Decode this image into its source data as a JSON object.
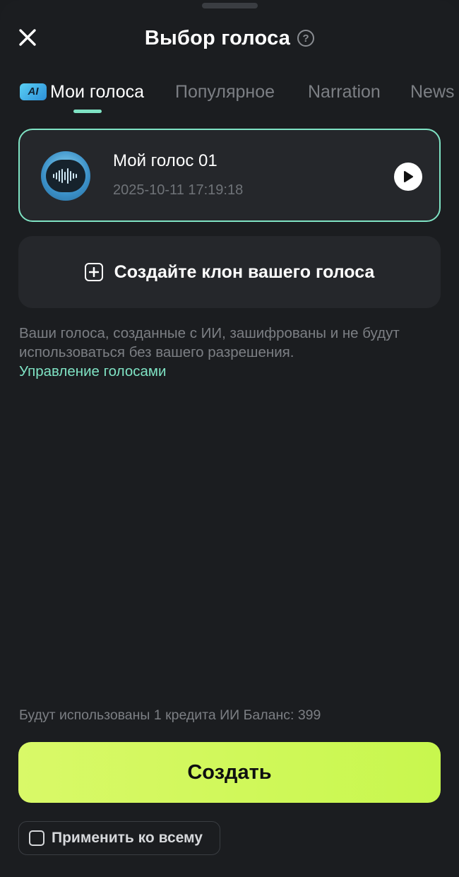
{
  "header": {
    "title": "Выбор голоса",
    "close_icon": "close-icon",
    "help_icon": "question-circle-icon"
  },
  "tabs": [
    {
      "label": "Мои голоса",
      "badge": "AI",
      "active": true
    },
    {
      "label": "Популярное",
      "active": false
    },
    {
      "label": "Narration",
      "active": false
    },
    {
      "label": "News",
      "active": false
    }
  ],
  "voices": [
    {
      "name": "Мой голос 01",
      "date": "2025-10-11 17:19:18",
      "selected": true,
      "avatar_icon": "waveform-avatar-icon",
      "play_icon": "play-icon"
    }
  ],
  "clone": {
    "label": "Создайте клон вашего голоса",
    "icon": "plus-square-icon"
  },
  "privacy": {
    "text": "Ваши голоса, созданные с ИИ, зашифрованы и не будут использоваться без вашего разрешения.",
    "link": "Управление голосами"
  },
  "footer": {
    "credits": "Будут использованы 1 кредита ИИ Баланс: 399",
    "create_label": "Создать",
    "apply_all_label": "Применить ко всему",
    "apply_all_checked": false
  },
  "colors": {
    "background": "#1b1d20",
    "card": "#25272b",
    "accent": "#7fe3c4",
    "primary_button": "#d2f85c",
    "muted_text": "#7c7f84"
  }
}
